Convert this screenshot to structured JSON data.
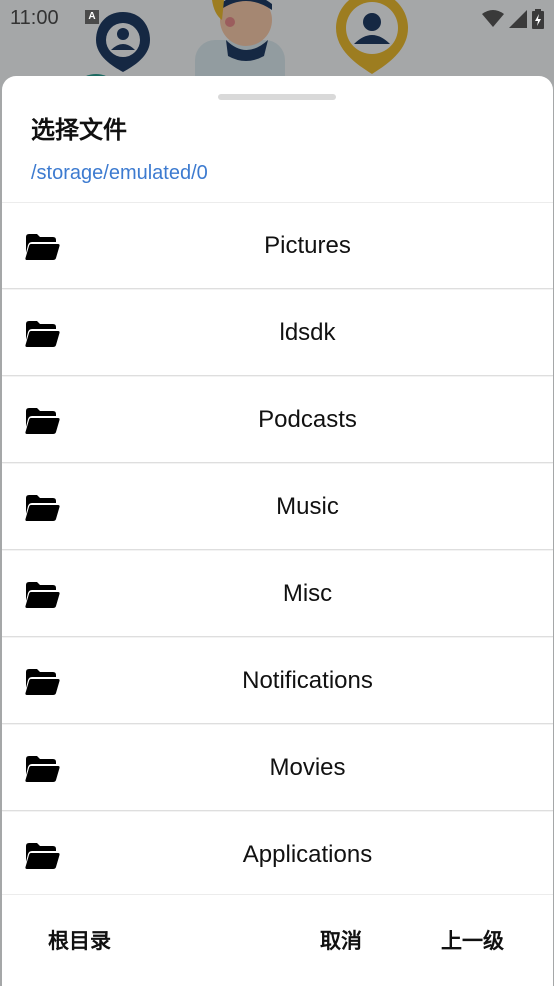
{
  "status_bar": {
    "time": "11:00",
    "notification_icon": "A",
    "icons": [
      "wifi-icon",
      "signal-icon",
      "battery-icon"
    ]
  },
  "dialog": {
    "title": "选择文件",
    "current_path": "/storage/emulated/0",
    "folders": [
      {
        "name": "Pictures",
        "icon": "folder-icon"
      },
      {
        "name": "ldsdk",
        "icon": "folder-icon"
      },
      {
        "name": "Podcasts",
        "icon": "folder-icon"
      },
      {
        "name": "Music",
        "icon": "folder-icon"
      },
      {
        "name": "Misc",
        "icon": "folder-icon"
      },
      {
        "name": "Notifications",
        "icon": "folder-icon"
      },
      {
        "name": "Movies",
        "icon": "folder-icon"
      },
      {
        "name": "Applications",
        "icon": "folder-icon"
      }
    ],
    "footer": {
      "root_label": "根目录",
      "cancel_label": "取消",
      "up_label": "上一级"
    }
  },
  "colors": {
    "path_text": "#3d7bd0",
    "scrim": "rgba(0,0,0,0.32)",
    "accent_yellow": "#e8b830"
  }
}
